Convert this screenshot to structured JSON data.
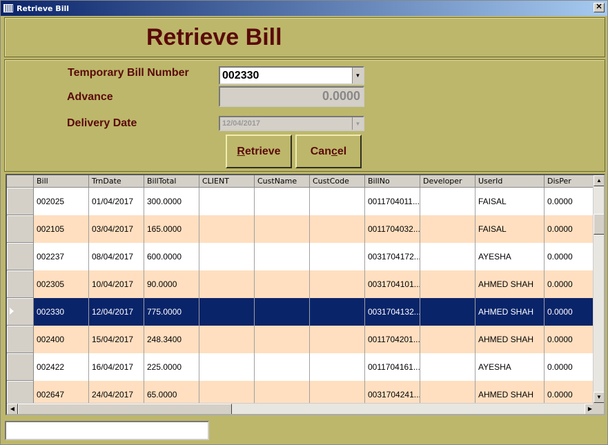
{
  "window": {
    "title": "Retrieve Bill",
    "close_glyph": "✕"
  },
  "header": {
    "heading": "Retrieve Bill"
  },
  "form": {
    "bill_number_label": "Temporary Bill Number",
    "bill_number_value": "002330",
    "advance_label": "Advance",
    "advance_value": "0.0000",
    "delivery_date_label": "Delivery Date",
    "delivery_date_value": "12/04/2017",
    "retrieve_button": {
      "underlined": "R",
      "rest": "etrieve"
    },
    "cancel_button": {
      "before": "Can",
      "underlined": "c",
      "after": "el"
    }
  },
  "grid": {
    "columns": [
      "Bill",
      "TrnDate",
      "BillTotal",
      "CLIENT",
      "CustName",
      "CustCode",
      "BillNo",
      "Developer",
      "UserId",
      "DisPer"
    ],
    "selected_index": 4,
    "rows": [
      [
        "002025",
        "01/04/2017",
        "300.0000",
        "",
        "",
        "",
        "0011704011...",
        "",
        "FAISAL",
        "0.0000"
      ],
      [
        "002105",
        "03/04/2017",
        "165.0000",
        "",
        "",
        "",
        "0011704032...",
        "",
        "FAISAL",
        "0.0000"
      ],
      [
        "002237",
        "08/04/2017",
        "600.0000",
        "",
        "",
        "",
        "0031704172...",
        "",
        "AYESHA",
        "0.0000"
      ],
      [
        "002305",
        "10/04/2017",
        "90.0000",
        "",
        "",
        "",
        "0031704101...",
        "",
        "AHMED SHAH",
        "0.0000"
      ],
      [
        "002330",
        "12/04/2017",
        "775.0000",
        "",
        "",
        "",
        "0031704132...",
        "",
        "AHMED SHAH",
        "0.0000"
      ],
      [
        "002400",
        "15/04/2017",
        "248.3400",
        "",
        "",
        "",
        "0011704201...",
        "",
        "AHMED SHAH",
        "0.0000"
      ],
      [
        "002422",
        "16/04/2017",
        "225.0000",
        "",
        "",
        "",
        "0011704161...",
        "",
        "AYESHA",
        "0.0000"
      ],
      [
        "002647",
        "24/04/2017",
        "65.0000",
        "",
        "",
        "",
        "0031704241...",
        "",
        "AHMED SHAH",
        "0.0000"
      ]
    ]
  },
  "status": {
    "text": ""
  },
  "colors": {
    "panel": "#bdb76b",
    "label": "#5a0a0a",
    "peach_row": "#ffdfc0",
    "selected_row": "#0a246a"
  },
  "icons": {
    "app": "app-icon",
    "dropdown": "chevron-down-icon",
    "row_pointer": "row-pointer-icon"
  }
}
